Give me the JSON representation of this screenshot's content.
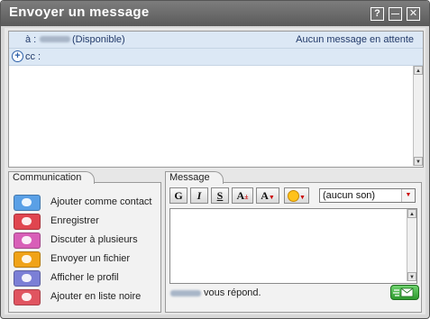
{
  "window": {
    "title": "Envoyer un message",
    "buttons": {
      "help": "?",
      "minimize": "—",
      "close": "✕"
    }
  },
  "conversation": {
    "to_label": "à :",
    "contact_status": "(Disponible)",
    "no_message": "Aucun message en attente",
    "cc_label": "cc :"
  },
  "communication": {
    "title": "Communication",
    "actions": [
      {
        "label": "Ajouter comme contact",
        "icon": "add-contact-icon",
        "color": "#5aa0e6"
      },
      {
        "label": "Enregistrer",
        "icon": "save-icon",
        "color": "#e0454f"
      },
      {
        "label": "Discuter à plusieurs",
        "icon": "group-chat-icon",
        "color": "#d85fb8"
      },
      {
        "label": "Envoyer un fichier",
        "icon": "send-file-icon",
        "color": "#f0a318"
      },
      {
        "label": "Afficher le profil",
        "icon": "profile-icon",
        "color": "#7b7fd6"
      },
      {
        "label": "Ajouter en liste noire",
        "icon": "blacklist-icon",
        "color": "#e05460"
      }
    ]
  },
  "message": {
    "title": "Message",
    "format_buttons": {
      "bold": "G",
      "italic": "I",
      "underline": "S",
      "font_size": "A",
      "font_color": "A"
    },
    "sound_value": "(aucun son)",
    "reply_suffix": "vous répond."
  }
}
